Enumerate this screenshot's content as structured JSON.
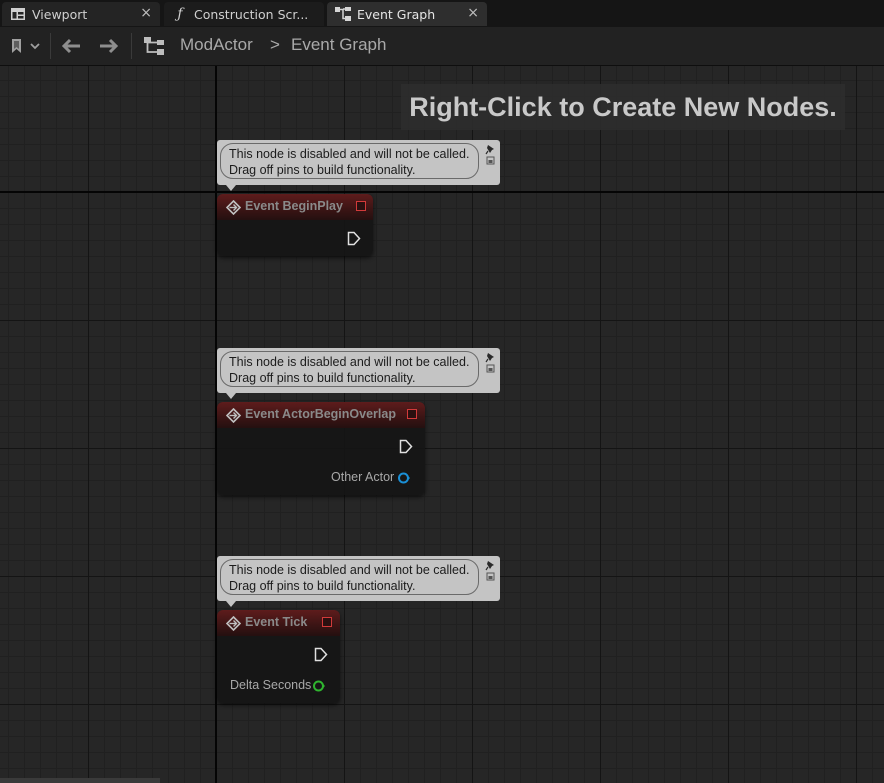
{
  "tabs": [
    {
      "label": "Viewport",
      "icon": "viewport-grid-icon",
      "active": false,
      "close": "×"
    },
    {
      "label": "Construction Scr...",
      "icon": "function-icon",
      "active": false,
      "close": ""
    },
    {
      "label": "Event Graph",
      "icon": "graph-icon",
      "active": true,
      "close": "×"
    }
  ],
  "toolbar": {
    "bookmark_icon": "bookmark-icon",
    "back_icon": "arrow-left-icon",
    "forward_icon": "arrow-right-icon",
    "graph_icon": "graph-hierarchy-icon",
    "breadcrumb": [
      "ModActor",
      "Event Graph"
    ],
    "breadcrumb_separator": ">"
  },
  "graph": {
    "hint": "Right-Click to Create New Nodes.",
    "disabled_comment": [
      "This node is disabled and will not be called.",
      "Drag off pins to build functionality."
    ],
    "nodes": [
      {
        "title": "Event BeginPlay",
        "pins": []
      },
      {
        "title": "Event ActorBeginOverlap",
        "pins": [
          {
            "label": "Other Actor",
            "color": "#1a8fd6"
          }
        ]
      },
      {
        "title": "Event Tick",
        "pins": [
          {
            "label": "Delta Seconds",
            "color": "#2fb52f"
          }
        ]
      }
    ]
  },
  "colors": {
    "node_header": "#5e1c1c",
    "delegate_pin": "#d23a3a",
    "object_pin": "#1a8fd6",
    "float_pin": "#2fb52f"
  }
}
